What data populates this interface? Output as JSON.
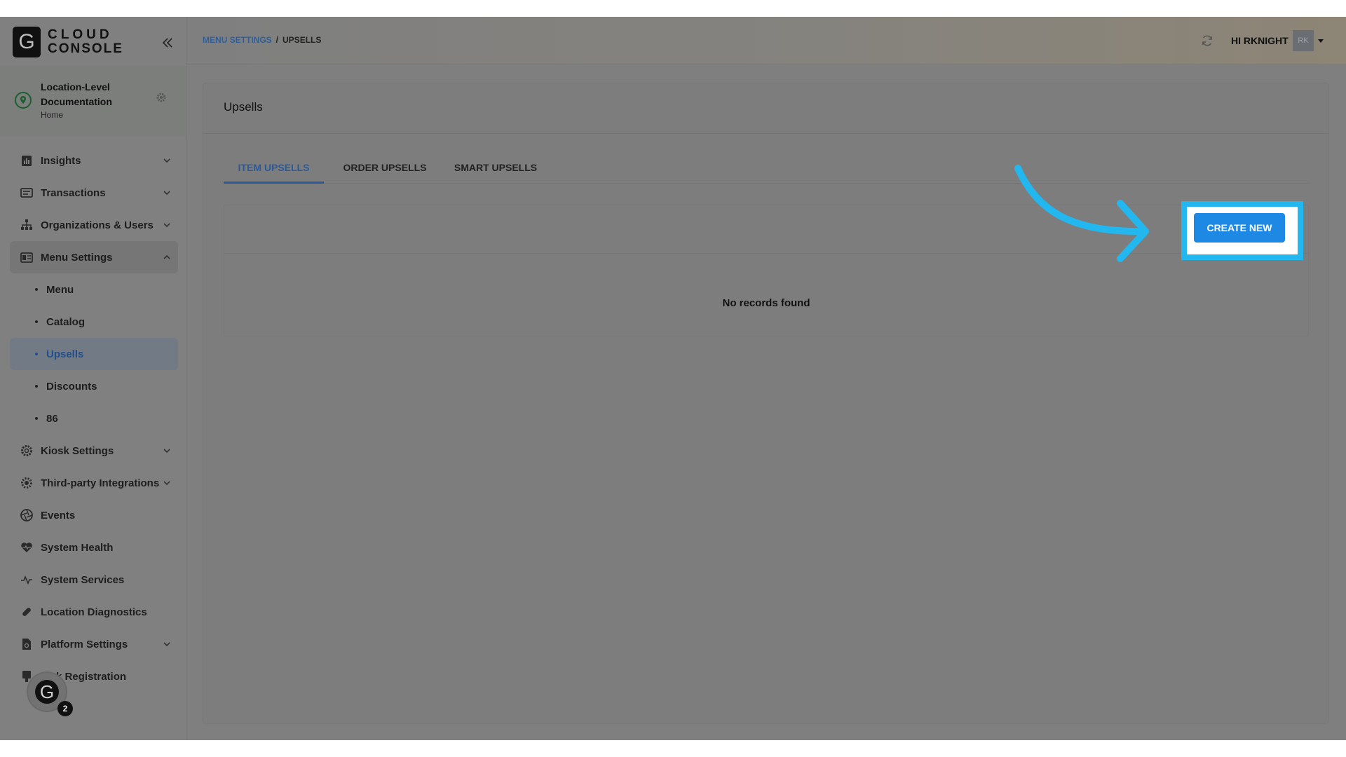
{
  "app": {
    "logo_letter": "G",
    "logo_line1": "CLOUD",
    "logo_line2": "CONSOLE"
  },
  "location": {
    "name": "Location-Level Documentation",
    "sub": "Home"
  },
  "sidebar": {
    "items": [
      {
        "label": "Insights"
      },
      {
        "label": "Transactions"
      },
      {
        "label": "Organizations & Users"
      },
      {
        "label": "Menu Settings"
      },
      {
        "label": "Kiosk Settings"
      },
      {
        "label": "Third-party Integrations"
      },
      {
        "label": "Events"
      },
      {
        "label": "System Health"
      },
      {
        "label": "System Services"
      },
      {
        "label": "Location Diagnostics"
      },
      {
        "label": "Platform Settings"
      },
      {
        "label": "k Registration"
      }
    ],
    "menu_sub": [
      {
        "label": "Menu"
      },
      {
        "label": "Catalog"
      },
      {
        "label": "Upsells"
      },
      {
        "label": "Discounts"
      },
      {
        "label": "86"
      }
    ]
  },
  "help": {
    "letter": "G",
    "badge": "2"
  },
  "header": {
    "breadcrumb_parent": "MENU SETTINGS",
    "breadcrumb_sep": "/",
    "breadcrumb_current": "UPSELLS",
    "greeting": "HI RKNIGHT",
    "avatar_initials": "RK"
  },
  "main": {
    "title": "Upsells",
    "tabs": [
      {
        "label": "ITEM UPSELLS"
      },
      {
        "label": "ORDER UPSELLS"
      },
      {
        "label": "SMART UPSELLS"
      }
    ],
    "empty_message": "No records found",
    "create_label": "CREATE NEW"
  },
  "colors": {
    "accent": "#1e88e5",
    "highlight": "#22b8ef",
    "active_link": "#2a5a99"
  }
}
